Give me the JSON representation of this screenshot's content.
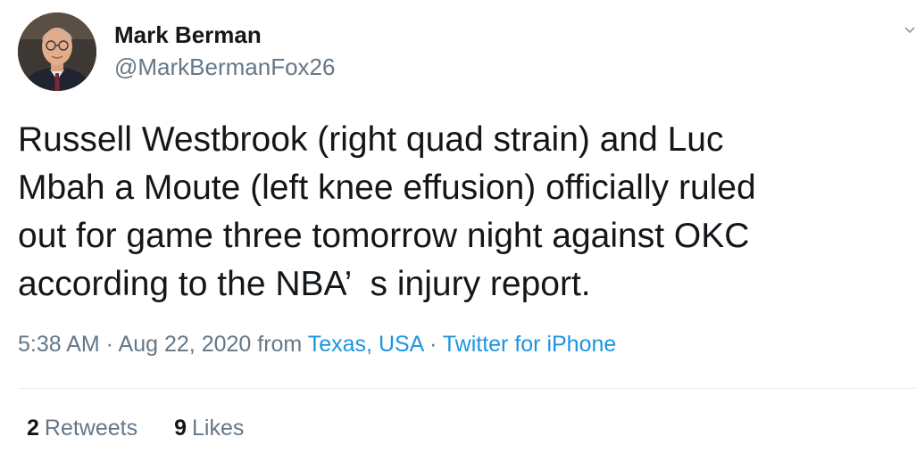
{
  "author": {
    "name": "Mark Berman",
    "handle": "@MarkBermanFox26"
  },
  "tweet": {
    "text": "Russell Westbrook (right quad strain) and Luc\nMbah a Moute (left knee effusion) officially ruled\nout for game three tomorrow night against OKC\naccording to the NBA’  s injury report."
  },
  "meta": {
    "timestamp": "5:38 AM · Aug 22, 2020 from",
    "location": "Texas, USA",
    "separator": "·",
    "source": "Twitter for iPhone"
  },
  "stats": {
    "retweets_count": "2",
    "retweets_label": "Retweets",
    "likes_count": "9",
    "likes_label": "Likes"
  },
  "icons": {
    "avatar": "profile-photo",
    "caret": "chevron-down-icon"
  },
  "colors": {
    "text_primary": "#14171a",
    "text_secondary": "#657786",
    "link": "#1b95e0",
    "divider": "#e6ecf0"
  }
}
